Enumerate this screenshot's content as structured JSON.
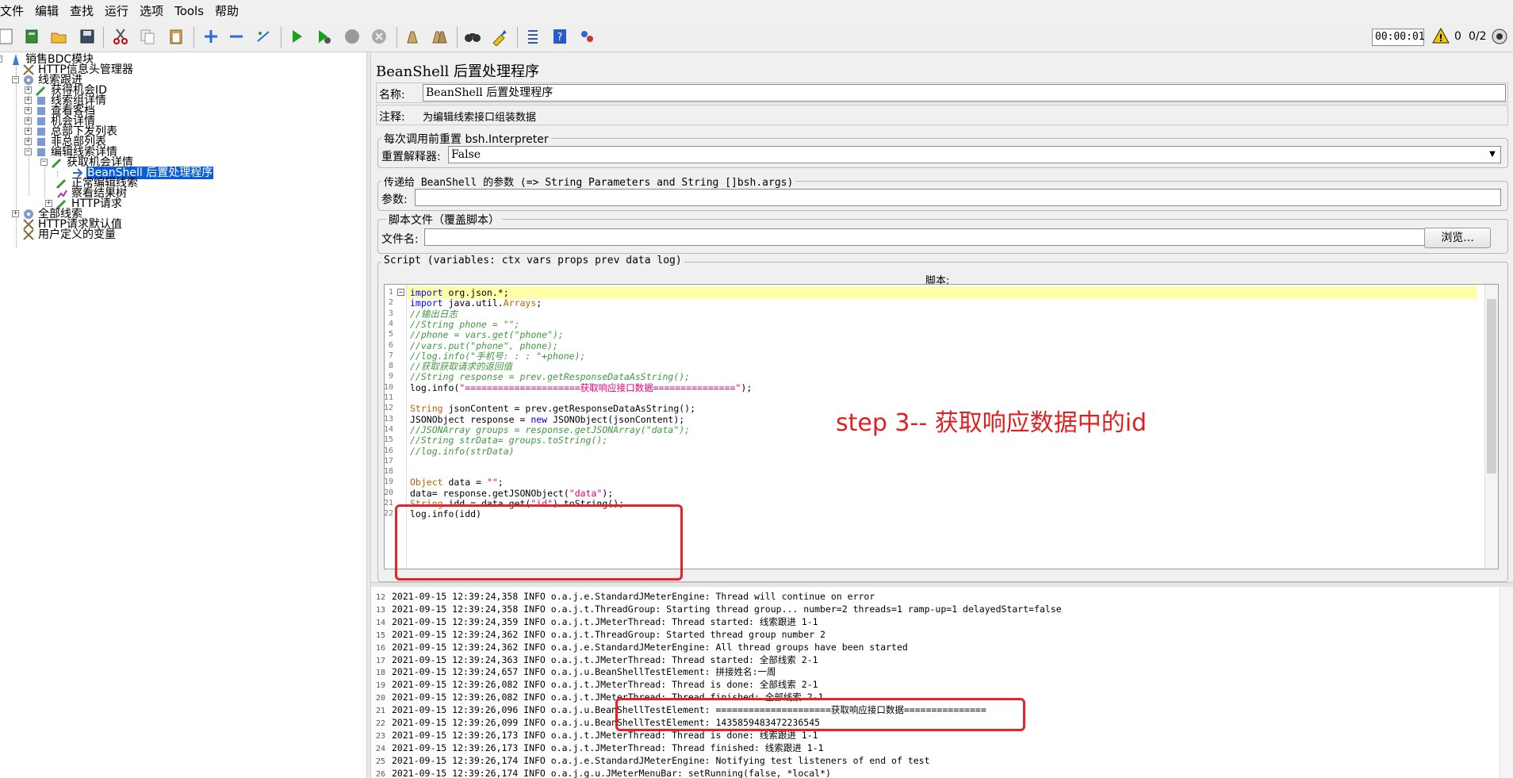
{
  "menu": [
    "文件",
    "编辑",
    "查找",
    "运行",
    "选项",
    "Tools",
    "帮助"
  ],
  "toolbar": {
    "timer": "00:00:01",
    "warning_count": "0",
    "threads": "0/2"
  },
  "tree": {
    "root": "销售BDC模块",
    "http_header_manager": "HTTP信息头管理器",
    "leads_follow": "线索跟进",
    "get_opportunity_id": "获得机会ID",
    "lead_group_detail": "线索组详情",
    "view_customer": "查看客档",
    "opportunity_detail": "机会详情",
    "hq_dispatch_list": "总部下发列表",
    "non_hq_list": "非总部列表",
    "edit_lead_detail": "编辑线索详情",
    "get_opportunity_detail": "获取机会详情",
    "beanshell_post": "BeanShell 后置处理程序",
    "normal_edit_lead": "正常编辑线索",
    "view_result_tree": "察看结果树",
    "http_request": "HTTP请求",
    "all_leads": "全部线索",
    "http_defaults": "HTTP请求默认值",
    "user_variables": "用户定义的变量"
  },
  "panel": {
    "title": "BeanShell 后置处理程序",
    "name_label": "名称:",
    "name_value": "BeanShell 后置处理程序",
    "comment_label": "注释:",
    "comment_value": "为编辑线索接口组装数据",
    "reset_group": "每次调用前重置 bsh.Interpreter",
    "reset_label": "重置解释器:",
    "reset_value": "False",
    "params_group": "传递给 BeanShell 的参数 (=> String Parameters and String []bsh.args)",
    "params_label": "参数:",
    "file_group": "脚本文件（覆盖脚本）",
    "file_label": "文件名:",
    "browse_button": "浏览...",
    "script_group": "Script (variables: ctx vars props prev data log)",
    "script_label": "脚本:"
  },
  "code": [
    "import org.json.*;",
    "import java.util.Arrays;",
    "//输出日志",
    "//String phone = \"\";",
    "//phone = vars.get(\"phone\");",
    "//vars.put(\"phone\", phone);",
    "//log.info(\"手机号: : : \"+phone);",
    "//获取获取请求的返回值",
    "//String response = prev.getResponseDataAsString();",
    "log.info(\"=====================获取响应接口数据===============\");",
    "",
    "String jsonContent = prev.getResponseDataAsString();",
    "JSONObject response = new JSONObject(jsonContent);",
    "//JSONArray groups = response.getJSONArray(\"data\");",
    "//String strData= groups.toString();",
    "//log.info(strData)",
    "",
    "",
    "Object data = \"\";",
    "data= response.getJSONObject(\"data\");",
    "String idd = data.get(\"id\").toString();",
    "log.info(idd)"
  ],
  "annotation": "step 3-- 获取响应数据中的id",
  "log": [
    {
      "n": "12",
      "text": "2021-09-15 12:39:24,358 INFO o.a.j.e.StandardJMeterEngine: Thread will continue on error"
    },
    {
      "n": "13",
      "text": "2021-09-15 12:39:24,358 INFO o.a.j.t.ThreadGroup: Starting thread group... number=2 threads=1 ramp-up=1 delayedStart=false"
    },
    {
      "n": "14",
      "text": "2021-09-15 12:39:24,359 INFO o.a.j.t.JMeterThread: Thread started: 线索跟进 1-1"
    },
    {
      "n": "15",
      "text": "2021-09-15 12:39:24,362 INFO o.a.j.t.ThreadGroup: Started thread group number 2"
    },
    {
      "n": "16",
      "text": "2021-09-15 12:39:24,362 INFO o.a.j.e.StandardJMeterEngine: All thread groups have been started"
    },
    {
      "n": "17",
      "text": "2021-09-15 12:39:24,363 INFO o.a.j.t.JMeterThread: Thread started: 全部线索 2-1"
    },
    {
      "n": "18",
      "text": "2021-09-15 12:39:24,657 INFO o.a.j.u.BeanShellTestElement: 拼接姓名:一周"
    },
    {
      "n": "19",
      "text": "2021-09-15 12:39:26,082 INFO o.a.j.t.JMeterThread: Thread is done: 全部线索 2-1"
    },
    {
      "n": "20",
      "text": "2021-09-15 12:39:26,082 INFO o.a.j.t.JMeterThread: Thread finished: 全部线索 2-1"
    },
    {
      "n": "21",
      "text": "2021-09-15 12:39:26,096 INFO o.a.j.u.BeanShellTestElement: =====================获取响应接口数据==============="
    },
    {
      "n": "22",
      "text": "2021-09-15 12:39:26,099 INFO o.a.j.u.BeanShellTestElement: 1435859483472236545"
    },
    {
      "n": "23",
      "text": "2021-09-15 12:39:26,173 INFO o.a.j.t.JMeterThread: Thread is done: 线索跟进 1-1"
    },
    {
      "n": "24",
      "text": "2021-09-15 12:39:26,173 INFO o.a.j.t.JMeterThread: Thread finished: 线索跟进 1-1"
    },
    {
      "n": "25",
      "text": "2021-09-15 12:39:26,174 INFO o.a.j.e.StandardJMeterEngine: Notifying test listeners of end of test"
    },
    {
      "n": "26",
      "text": "2021-09-15 12:39:26,174 INFO o.a.j.g.u.JMeterMenuBar: setRunning(false, *local*)"
    }
  ],
  "colors": {
    "selection": "#0a5fd8",
    "annotation_red": "#e02020",
    "current_line": "#ffffaa"
  }
}
